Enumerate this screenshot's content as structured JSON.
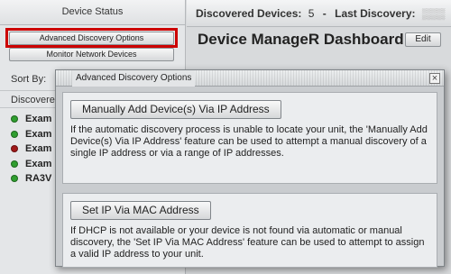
{
  "sidebar": {
    "header": "Device Status",
    "buttons": {
      "advanced": "Advanced Discovery Options",
      "monitor": "Monitor Network Devices"
    },
    "sort_by": "Sort By:",
    "discovered_label": "Discovere",
    "devices": [
      {
        "name": "Exam",
        "status_color": "#2f9e2f"
      },
      {
        "name": "Exam",
        "status_color": "#2f9e2f"
      },
      {
        "name": "Exam",
        "status_color": "#a01818"
      },
      {
        "name": "Exam",
        "status_color": "#2f9e2f"
      },
      {
        "name": "RA3V",
        "status_color": "#2f9e2f"
      }
    ]
  },
  "topbar": {
    "discovered_label": "Discovered Devices:",
    "discovered_count": "5",
    "separator": "-",
    "last_discovery_label": "Last Discovery:"
  },
  "main": {
    "title": "Device ManageR Dashboard",
    "edit_label": "Edit"
  },
  "dialog": {
    "title": "Advanced Discovery Options",
    "close_glyph": "×",
    "sections": [
      {
        "button": "Manually Add Device(s) Via IP Address",
        "description": "If the automatic discovery process is unable to locate your unit, the 'Manually Add Device(s) Via IP Address' feature can be used to attempt a manual discovery of a  single IP address or via a range of IP addresses."
      },
      {
        "button": "Set IP Via MAC Address",
        "description": "If DHCP is not available or your device is not found via automatic or manual discovery, the 'Set IP Via MAC Address' feature can be used to attempt to assign a valid IP address to your unit."
      }
    ]
  }
}
